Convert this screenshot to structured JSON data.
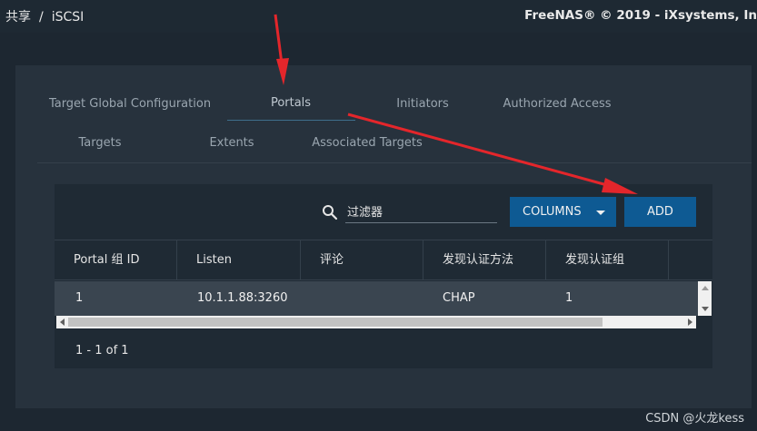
{
  "breadcrumb": {
    "items": [
      "共享",
      "/",
      "iSCSI"
    ]
  },
  "copyright": "FreeNAS® © 2019 - iXsystems, In",
  "tabs": [
    {
      "label": "Target Global Configuration"
    },
    {
      "label": "Portals"
    },
    {
      "label": "Initiators"
    },
    {
      "label": "Authorized Access"
    },
    {
      "label": "Targets"
    },
    {
      "label": "Extents"
    },
    {
      "label": "Associated Targets"
    }
  ],
  "active_tab": "Portals",
  "toolbar": {
    "filter_placeholder": "过滤器",
    "columns_label": "COLUMNS",
    "add_label": "ADD"
  },
  "table": {
    "columns": [
      "Portal 组 ID",
      "Listen",
      "评论",
      "发现认证方法",
      "发现认证组"
    ],
    "rows": [
      [
        "1",
        "10.1.1.88:3260",
        "",
        "CHAP",
        "1"
      ]
    ]
  },
  "pager": "1 - 1 of 1",
  "watermark": "CSDN @火龙kess",
  "colors": {
    "background": "#1d2731",
    "card": "#27323d",
    "panel": "#1f2a34",
    "button": "#0e5a93",
    "annotation_arrow": "#e4262b"
  },
  "icons": [
    "search-icon",
    "chevron-down-icon",
    "arrow-up-icon",
    "arrow-down-icon",
    "arrow-left-icon",
    "arrow-right-icon"
  ]
}
